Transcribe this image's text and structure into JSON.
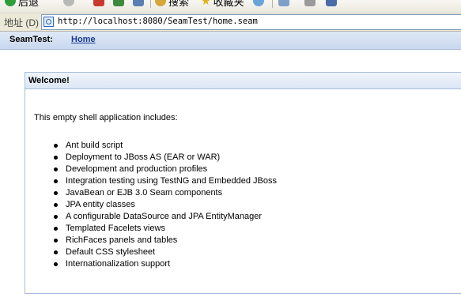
{
  "browser": {
    "toolbar": {
      "back_label": "后退",
      "search_label": "搜索",
      "favorites_label": "收藏夹"
    },
    "address": {
      "label": "地址 (D)",
      "url": "http://localhost:8080/SeamTest/home.seam"
    }
  },
  "app": {
    "title": "SeamTest:",
    "menu": {
      "home_label": "Home"
    }
  },
  "panel": {
    "header": "Welcome!",
    "intro": "This empty shell application includes:",
    "features": [
      "Ant build script",
      "Deployment to JBoss AS (EAR or WAR)",
      "Development and production profiles",
      "Integration testing using TestNG and Embedded JBoss",
      "JavaBean or EJB 3.0 Seam components",
      "JPA entity classes",
      "A configurable DataSource and JPA EntityManager",
      "Templated Facelets views",
      "RichFaces panels and tables",
      "Default CSS stylesheet",
      "Internationalization support"
    ]
  }
}
